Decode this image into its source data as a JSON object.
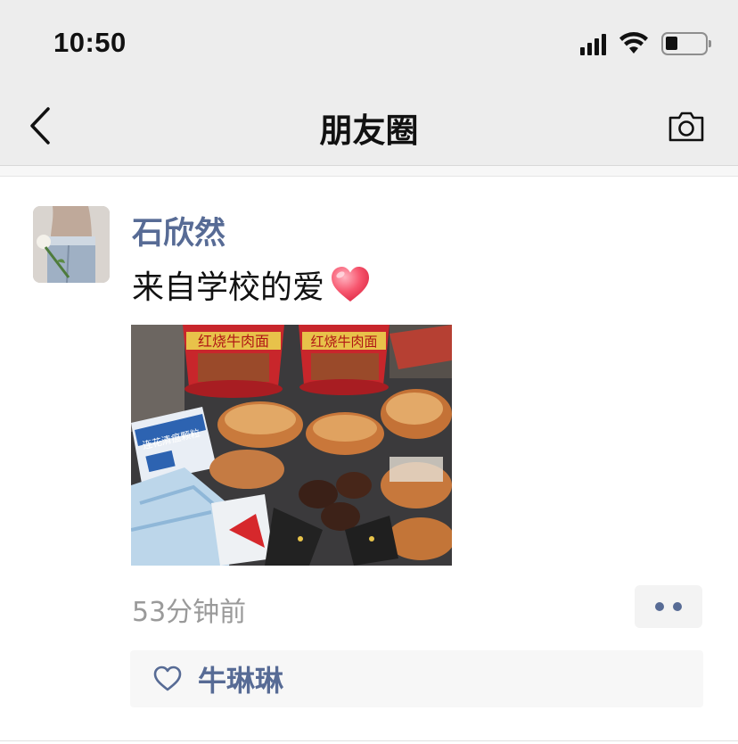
{
  "status_bar": {
    "time": "10:50"
  },
  "nav": {
    "title": "朋友圈"
  },
  "post": {
    "author": "石欣然",
    "content": "来自学校的爱",
    "photo_texts": [
      "红烧牛肉面",
      "红烧牛肉面",
      "连花清瘟颗粒"
    ],
    "timestamp": "53分钟前",
    "likes": [
      "牛琳琳"
    ]
  },
  "colors": {
    "link": "#576b95",
    "bar_bg": "#ededed",
    "timestamp": "#9a9a9a"
  },
  "icons": [
    "signal-icon",
    "wifi-icon",
    "battery-icon",
    "back-arrow-icon",
    "camera-icon",
    "heart-emoji-icon",
    "more-dots-icon",
    "like-heart-icon"
  ]
}
